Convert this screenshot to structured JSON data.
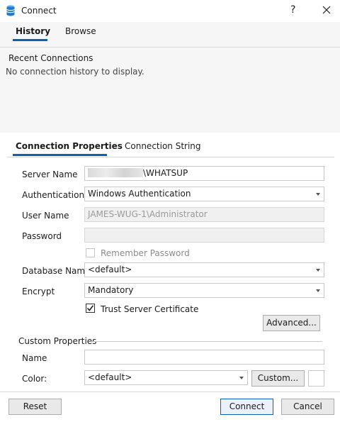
{
  "window": {
    "title": "Connect",
    "help_glyph": "?"
  },
  "top_tabs": [
    "History",
    "Browse"
  ],
  "history": {
    "heading": "Recent Connections",
    "empty_text": "No connection history to display."
  },
  "prop_tabs": [
    "Connection Properties",
    "Connection String"
  ],
  "labels": {
    "server_name": "Server Name",
    "authentication": "Authentication",
    "user_name": "User Name",
    "password": "Password",
    "remember_password": "Remember Password",
    "database_name": "Database Name",
    "encrypt": "Encrypt",
    "trust_cert": "Trust Server Certificate",
    "custom_properties": "Custom Properties",
    "name": "Name",
    "color": "Color:"
  },
  "values": {
    "server_name_suffix": "\\WHATSUP",
    "authentication": "Windows Authentication",
    "user_name": "JAMES-WUG-1\\Administrator",
    "password": "",
    "database_name": "<default>",
    "encrypt": "Mandatory",
    "name": "",
    "color": "<default>"
  },
  "checks": {
    "remember_password": false,
    "trust_cert": true
  },
  "buttons": {
    "advanced": "Advanced...",
    "custom": "Custom...",
    "reset": "Reset",
    "connect": "Connect",
    "cancel": "Cancel"
  },
  "colors": {
    "accent": "#0c60b6",
    "app_icon": "#1e7dc9"
  }
}
